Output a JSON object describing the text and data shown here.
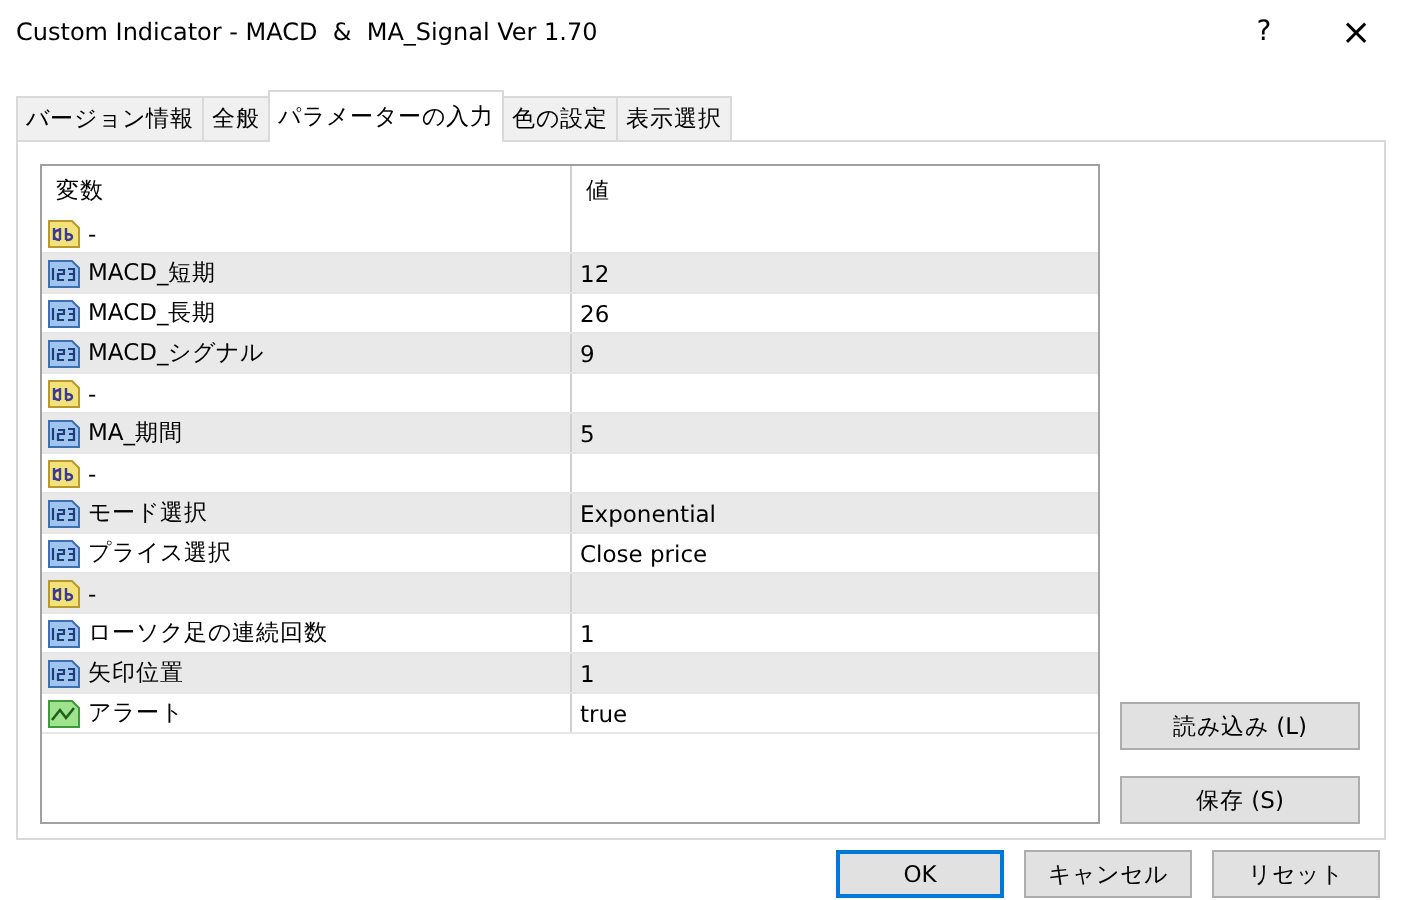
{
  "window": {
    "title": "Custom Indicator - MACD  &  MA_Signal Ver 1.70",
    "help": "?",
    "close": "×"
  },
  "tabs": [
    {
      "label": "バージョン情報",
      "selected": false
    },
    {
      "label": "全般",
      "selected": false
    },
    {
      "label": "パラメーターの入力",
      "selected": true
    },
    {
      "label": "色の設定",
      "selected": false
    },
    {
      "label": "表示選択",
      "selected": false
    }
  ],
  "table": {
    "columns": [
      "変数",
      "値"
    ],
    "rows": [
      {
        "kind": "string",
        "name": "-",
        "value": ""
      },
      {
        "kind": "number",
        "name": "MACD_短期",
        "value": "12"
      },
      {
        "kind": "number",
        "name": "MACD_長期",
        "value": "26"
      },
      {
        "kind": "number",
        "name": "MACD_シグナル",
        "value": "9"
      },
      {
        "kind": "string",
        "name": "-",
        "value": ""
      },
      {
        "kind": "number",
        "name": "MA_期間",
        "value": "5"
      },
      {
        "kind": "string",
        "name": "-",
        "value": ""
      },
      {
        "kind": "number",
        "name": "モード選択",
        "value": "Exponential"
      },
      {
        "kind": "number",
        "name": "プライス選択",
        "value": "Close price"
      },
      {
        "kind": "string",
        "name": "-",
        "value": ""
      },
      {
        "kind": "number",
        "name": "ローソク足の連続回数",
        "value": "1"
      },
      {
        "kind": "number",
        "name": "矢印位置",
        "value": "1"
      },
      {
        "kind": "bool",
        "name": "アラート",
        "value": "true"
      }
    ]
  },
  "side_buttons": [
    "読み込み (L)",
    "保存 (S)"
  ],
  "buttons": [
    {
      "label": "OK",
      "default": true
    },
    {
      "label": "キャンセル",
      "default": false
    },
    {
      "label": "リセット",
      "default": false
    }
  ]
}
